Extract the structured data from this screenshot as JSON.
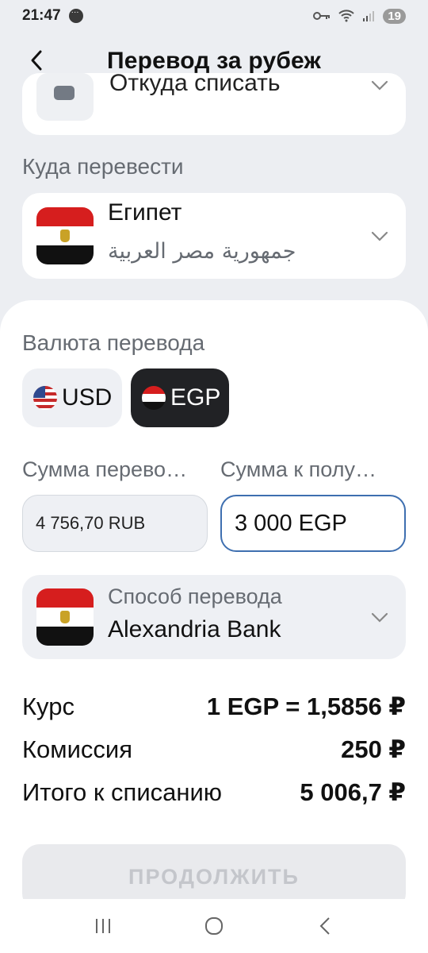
{
  "status_bar": {
    "time": "21:47",
    "battery": "19"
  },
  "header": {
    "title": "Перевод за рубеж"
  },
  "source": {
    "label": "Откуда списать"
  },
  "destination": {
    "section_label": "Куда перевести",
    "country_name": "Египет",
    "country_native": "جمهورية مصر العربية"
  },
  "currency": {
    "section_label": "Валюта перевода",
    "options": [
      {
        "code": "USD",
        "selected": false
      },
      {
        "code": "EGP",
        "selected": true
      }
    ]
  },
  "amounts": {
    "send_label": "Сумма перево…",
    "receive_label": "Сумма к полу…",
    "send_value": "4 756,70 RUB",
    "receive_value": "3 000 EGP"
  },
  "method": {
    "label": "Способ перевода",
    "value": "Alexandria Bank"
  },
  "summary": [
    {
      "label": "Курс",
      "value": "1 EGP = 1,5856 ₽"
    },
    {
      "label": "Комиссия",
      "value": "250 ₽"
    },
    {
      "label": "Итого к списанию",
      "value": "5 006,7 ₽"
    }
  ],
  "continue_button": {
    "label": "ПРОДОЛЖИТЬ",
    "enabled": false
  },
  "colors": {
    "accent_border": "#3e6fb0",
    "selected_currency_bg": "#212225"
  }
}
